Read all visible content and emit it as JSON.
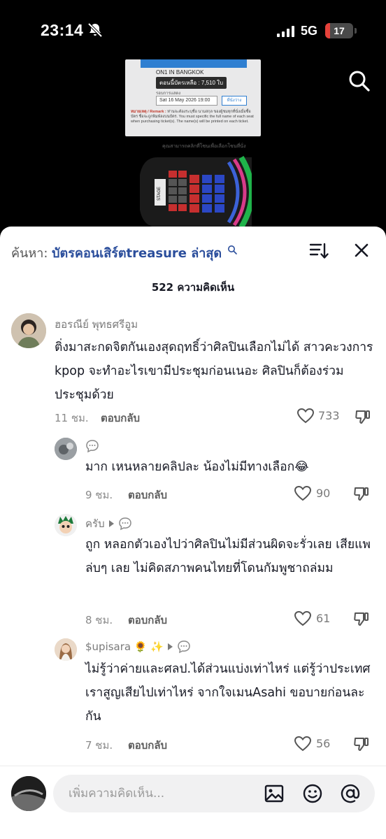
{
  "status_bar": {
    "time": "23:14",
    "network": "5G",
    "battery": "17",
    "battery_level": 0.17
  },
  "video": {
    "ticket_banner": "",
    "city": "ON1 IN BANGKOK",
    "remaining": "ตอนนี้บัตรเหลือ : 7,510 ใบ",
    "round_label": "รอบการแสดง",
    "date_option": "Sat 16 May 2026 19:00",
    "seat_button": "ที่นั่งว่าง",
    "remark_label": "หมายเหตุ / Remark :",
    "remark_text": "ท่านจะต้องระบุชื่อ นามสกุล ของผู้ชมทุกที่นั่งเมื่อซื้อบัตร ชื่อจะถูกพิมพ์ลงบนบัตร. You must specific the full name of each seat when purchasing ticket(s). The name(s) will be printed on each ticket.",
    "stage_caption": "คุณสามารถคลิกที่โซนเพื่อเลือกโซนที่นั่ง",
    "stage_label": "STAGE"
  },
  "header": {
    "search_prefix": "ค้นหา:",
    "search_query": "บัตรคอนเสิร์ตtreasure ล่าสุด",
    "comment_count": "522 ความคิดเห็น"
  },
  "comments": [
    {
      "username": "ฮอรณีย์ พุทธศรีอูม",
      "text": "ติ่งมาสะกดจิตกันเองสุดฤทธิ์ว่าศิลปินเลือกไม่ได้ สาวคะวงการ kpop จะทำอะไรเขามีประชุมก่อนเนอะ ศิลปินก็ต้องร่วมประชุมด้วย",
      "time": "11 ชม.",
      "reply": "ตอบกลับ",
      "likes": "733"
    },
    {
      "username": "",
      "text": "มาก เหนหลายคลิปละ น้องไม่มีทางเลือก😂",
      "time": "9 ชม.",
      "reply": "ตอบกลับ",
      "likes": "90"
    },
    {
      "username": "ครับ",
      "text": "ถูก หลอกตัวเองไปว่าศิลปินไม่มีส่วนผิดจะรั่วเลย เสียแพล่บๆ เลย ไม่คิดสภาพคนไทยที่โดนกัมพูชาถล่มม",
      "time": "8 ชม.",
      "reply": "ตอบกลับ",
      "likes": "61"
    },
    {
      "username": "$upisara 🌻 ✨",
      "text": "ไม่รู้ว่าค่ายและศลป.ได้ส่วนแบ่งเท่าไหร่ แต่รู้ว่าประเทศเราสูญเสียไปเท่าไหร่ จากใจเมนAsahi ขอบายก่อนละกัน",
      "time": "7 ชม.",
      "reply": "ตอบกลับ",
      "likes": "56"
    }
  ],
  "input": {
    "placeholder": "เพิ่มความคิดเห็น..."
  }
}
